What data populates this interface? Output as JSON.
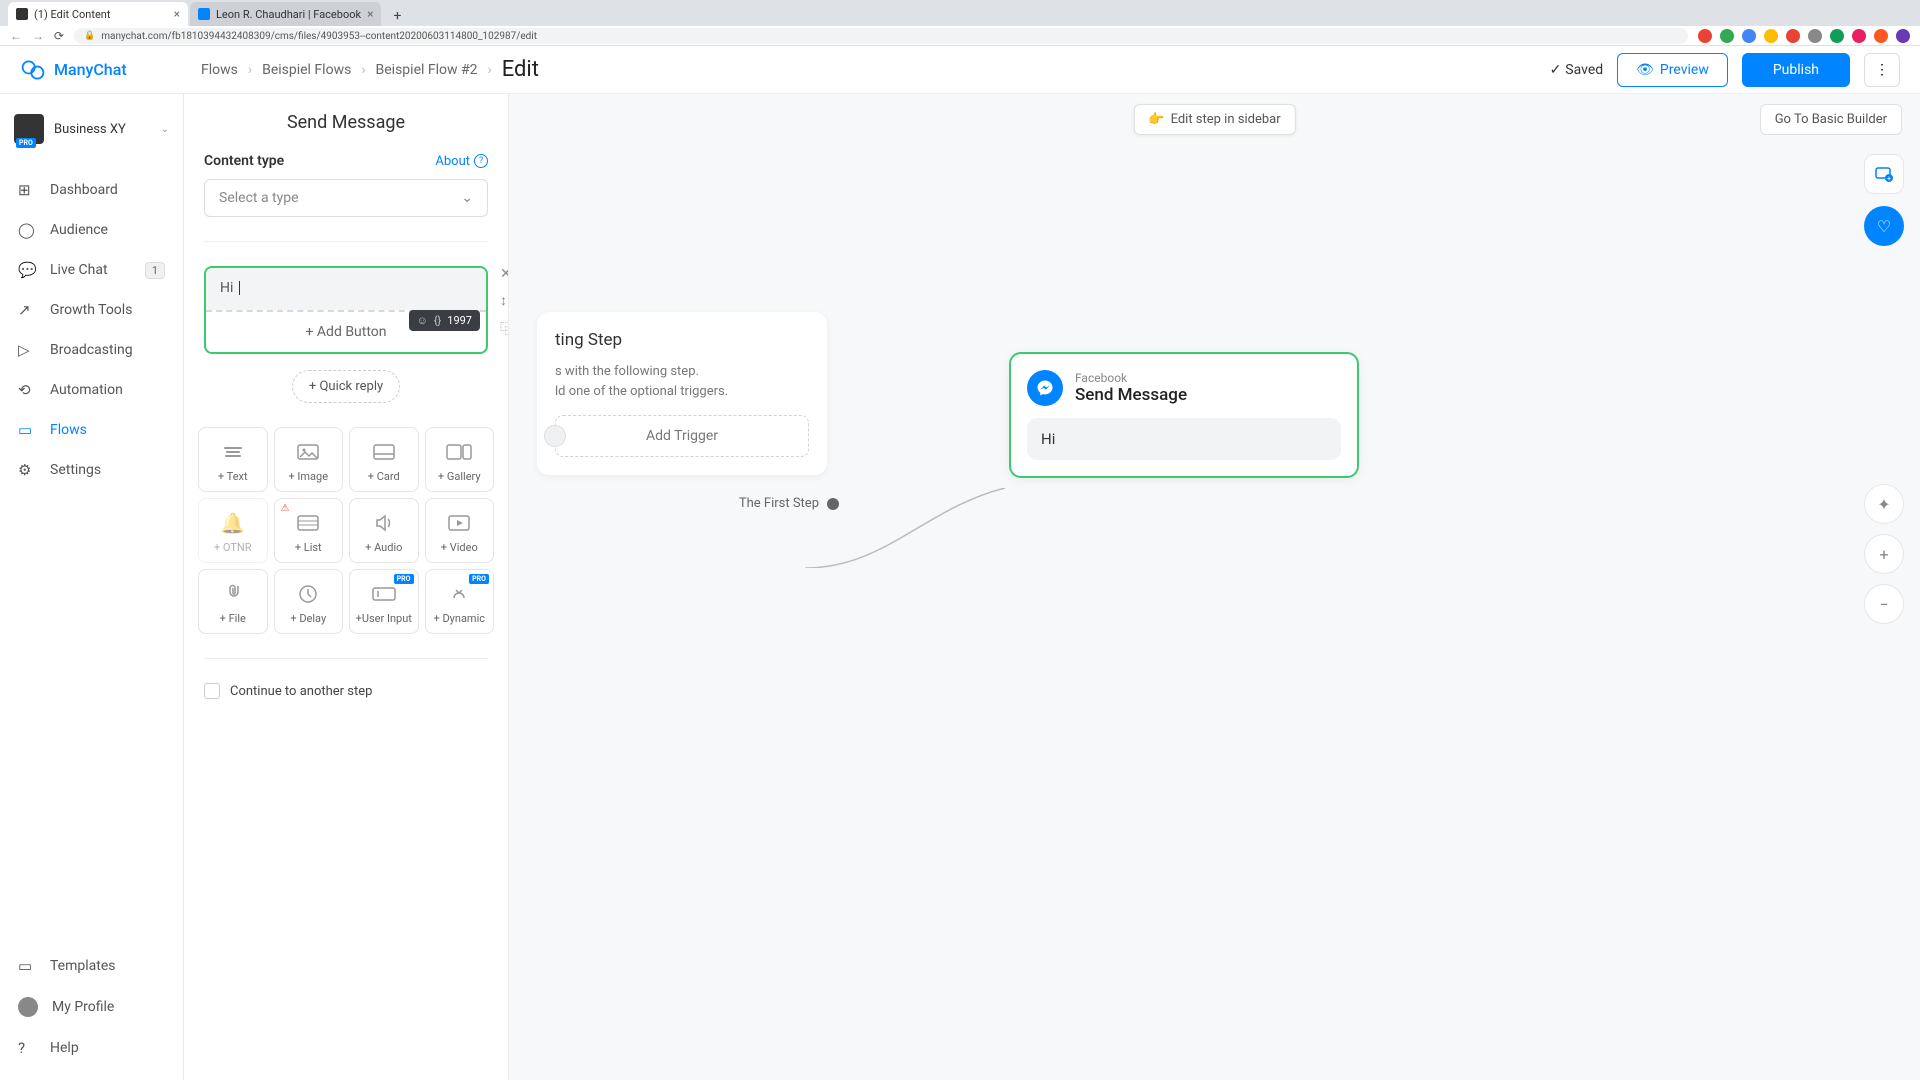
{
  "browser": {
    "tabs": [
      {
        "favicon": "mc",
        "title": "(1) Edit Content"
      },
      {
        "favicon": "fb",
        "title": "Leon R. Chaudhari | Facebook"
      }
    ],
    "url": "manychat.com/fb181039443240830​9/cms/files/4903953--content20200603114800_102987/edit"
  },
  "header": {
    "logo": "ManyChat",
    "breadcrumb": [
      "Flows",
      "Beispiel Flows",
      "Beispiel Flow #2"
    ],
    "current": "Edit",
    "saved": "Saved",
    "preview": "Preview",
    "publish": "Publish"
  },
  "workspace": {
    "name": "Business XY",
    "badge": "PRO"
  },
  "nav": [
    {
      "icon": "⊞",
      "label": "Dashboard"
    },
    {
      "icon": "◯",
      "label": "Audience"
    },
    {
      "icon": "💬",
      "label": "Live Chat",
      "badge": "1"
    },
    {
      "icon": "↗",
      "label": "Growth Tools"
    },
    {
      "icon": "▷",
      "label": "Broadcasting"
    },
    {
      "icon": "⟲",
      "label": "Automation"
    },
    {
      "icon": "▭",
      "label": "Flows",
      "active": true
    },
    {
      "icon": "⚙",
      "label": "Settings"
    }
  ],
  "nav_bottom": [
    {
      "icon": "▭",
      "label": "Templates"
    },
    {
      "icon": "avatar",
      "label": "My Profile"
    },
    {
      "icon": "?",
      "label": "Help"
    }
  ],
  "editor": {
    "title": "Send Message",
    "content_type_label": "Content type",
    "about": "About",
    "select_placeholder": "Select a type",
    "text_value": "Hi ",
    "char_count": "1997",
    "add_button": "+ Add Button",
    "quick_reply": "+ Quick reply",
    "blocks": [
      {
        "label": "+ Text",
        "icon": "text"
      },
      {
        "label": "+ Image",
        "icon": "image"
      },
      {
        "label": "+ Card",
        "icon": "card"
      },
      {
        "label": "+ Gallery",
        "icon": "gallery"
      },
      {
        "label": "+ OTNR",
        "icon": "bell",
        "disabled": true
      },
      {
        "label": "+ List",
        "icon": "list",
        "warn": true
      },
      {
        "label": "+ Audio",
        "icon": "audio"
      },
      {
        "label": "+ Video",
        "icon": "video"
      },
      {
        "label": "+ File",
        "icon": "file"
      },
      {
        "label": "+ Delay",
        "icon": "delay"
      },
      {
        "label": "+User Input",
        "icon": "input",
        "pro": true
      },
      {
        "label": "+ Dynamic",
        "icon": "dynamic",
        "pro": true
      }
    ],
    "continue": "Continue to another step"
  },
  "canvas": {
    "edit_sidebar": "Edit step in sidebar",
    "go_basic": "Go To Basic Builder",
    "start": {
      "title": "ting Step",
      "desc_l1": "s with the following step.",
      "desc_l2": "ld one of the optional triggers.",
      "add_trigger": "Add Trigger",
      "first_step": "The First Step"
    },
    "node": {
      "platform": "Facebook",
      "title": "Send Message",
      "message": "Hi"
    }
  }
}
